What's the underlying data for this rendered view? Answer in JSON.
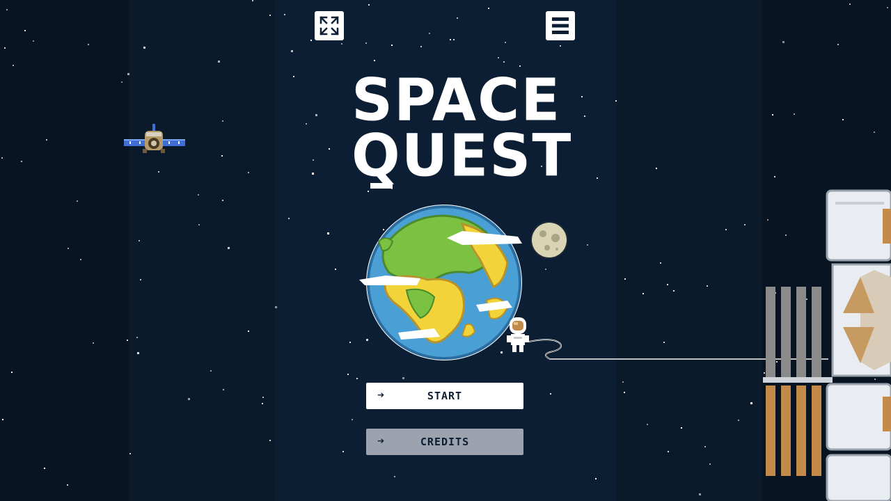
{
  "game": {
    "title_line1": "SPACE",
    "title_line2": "QUEST"
  },
  "toolbar": {
    "fullscreen_icon": "expand-icon",
    "menu_icon": "hamburger-menu-icon"
  },
  "menu": {
    "start_label": "START",
    "credits_label": "CREDITS",
    "arrow_glyph": "➔"
  },
  "colors": {
    "background": "#0c1e33",
    "button_primary": "#ffffff",
    "button_secondary": "#9da3ae",
    "earth_ocean": "#4a9fd4",
    "earth_land_green": "#7cc242",
    "earth_land_yellow": "#f2d43a"
  }
}
